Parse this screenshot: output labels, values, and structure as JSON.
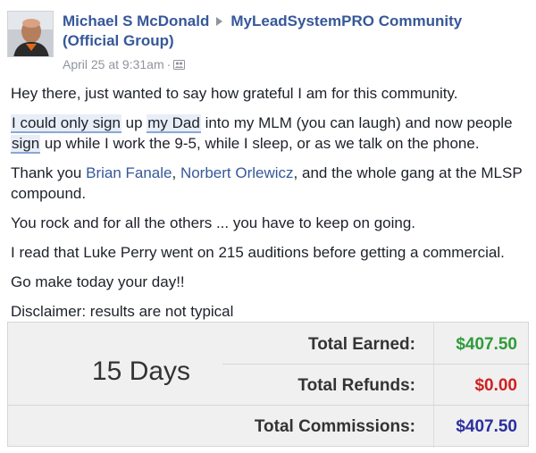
{
  "post": {
    "author": "Michael S McDonald",
    "group_line1": "MyLeadSystemPRO Community",
    "group_line2": "(Official Group)",
    "timestamp": "April 25 at 9:31am",
    "separator": "·",
    "audience_icon": "group-audience-icon",
    "paragraphs": {
      "p1": "Hey there, just wanted to say how grateful I am for this community.",
      "p2a": "I could only sign",
      "p2b": " up ",
      "p2c": "my Dad",
      "p2d": " into my MLM (you can laugh) and now people ",
      "p2e": "sign",
      "p2f": " up while I work the 9-5, while I sleep, or as we talk on the phone.",
      "p3a": "Thank you ",
      "p3_link1": "Brian Fanale",
      "p3b": ", ",
      "p3_link2": "Norbert Orlewicz",
      "p3c": ", and the whole gang at the MLSP compound.",
      "p4": "You rock and for all the others ... you have to keep on going.",
      "p5": "I read that Luke Perry went on 215 auditions before getting a commercial.",
      "p6": "Go make today your day!!",
      "p7": "Disclaimer: results are not typical"
    }
  },
  "receipt": {
    "period": "15 Days",
    "rows": [
      {
        "label": "Total Earned:",
        "value": "$407.50",
        "color": "#2e9b3a"
      },
      {
        "label": "Total Refunds:",
        "value": "$0.00",
        "color": "#d11f1f"
      },
      {
        "label": "Total Commissions:",
        "value": "$407.50",
        "color": "#2b2f9e"
      }
    ]
  },
  "colors": {
    "link": "#365899",
    "meta": "#90949c",
    "text": "#1d2129"
  }
}
